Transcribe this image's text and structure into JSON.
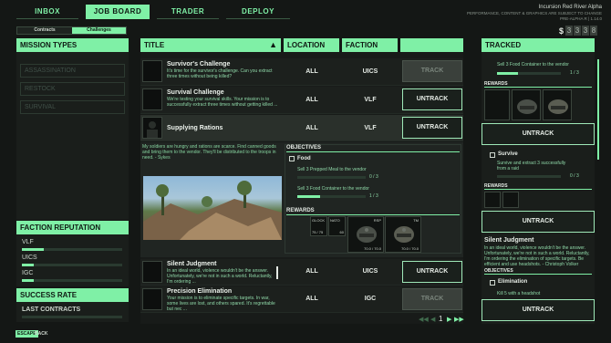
{
  "nav": {
    "tabs": [
      "INBOX",
      "JOB BOARD",
      "TRADER",
      "DEPLOY"
    ],
    "active": "JOB BOARD"
  },
  "build": {
    "line1": "Incursion Red River Alpha",
    "line2": "PERFORMANCE, CONTENT & GRAPHICS ARE SUBJECT TO CHANGE",
    "line3": "PRE-ALPHA R | 1.14.0"
  },
  "currency": {
    "symbol": "$",
    "digits": [
      "3",
      "3",
      "3",
      "8"
    ]
  },
  "sidebar": {
    "toggle": {
      "left": "Contracts",
      "right": "Challenges"
    },
    "mission_types_heading": "MISSION TYPES",
    "mission_types": [
      "ASSASSINATION",
      "RESTOCK",
      "SURVIVAL"
    ],
    "faction_rep_heading": "FACTION REPUTATION",
    "factions": [
      {
        "name": "VLF",
        "level": 0.22
      },
      {
        "name": "UICS",
        "level": 0.12
      },
      {
        "name": "IGC",
        "level": 0.12
      }
    ],
    "success_heading": "SUCCESS RATE",
    "last_contracts": "LAST CONTRACTS"
  },
  "table": {
    "headers": {
      "title": "TITLE",
      "location": "LOCATION",
      "faction": "FACTION"
    },
    "rows": [
      {
        "title": "Survivor's Challenge",
        "desc": "It's time for the survivor's challenge. Can you extract three times without being killed?",
        "location": "ALL",
        "faction": "UICS",
        "action": "TRACK",
        "disabled": true
      },
      {
        "title": "Survival Challenge",
        "desc": "We're testing your survival skills. Your mission is to successfully extract three times without getting killed ...",
        "location": "ALL",
        "faction": "VLF",
        "action": "UNTRACK",
        "disabled": false
      },
      {
        "title": "Supplying Rations",
        "desc": "",
        "location": "ALL",
        "faction": "VLF",
        "action": "UNTRACK",
        "disabled": false
      }
    ],
    "bottom_rows": [
      {
        "title": "Silent Judgment",
        "desc": "In an ideal world, violence wouldn't be the answer. Unfortunately, we're not in such a world. Reluctantly, I'm ordering ...",
        "location": "ALL",
        "faction": "UICS",
        "action": "UNTRACK",
        "disabled": false
      },
      {
        "title": "Precision Elimination",
        "desc": "Your mission is to eliminate specific targets. In war, some lives are lost, and others spared. It's regrettable but nec ...",
        "location": "ALL",
        "faction": "IGC",
        "action": "TRACK",
        "disabled": true
      }
    ]
  },
  "detail": {
    "quote": "My soldiers are hungry and rations are scarce. Find canned goods and bring them to the vendor. They'll be distributed to the troops in need. - Sykes",
    "objectives_heading": "OBJECTIVES",
    "objective_group": "Food",
    "objectives": [
      {
        "text": "Sell 3 Prepped Meal to the vendor",
        "count": "0 / 3",
        "progress": 0.0
      },
      {
        "text": "Sell 3 Food Container to the vendor",
        "count": "1 / 3",
        "progress": 0.33
      }
    ],
    "rewards_heading": "REWARDS",
    "rewards": [
      {
        "name": "GLOCK",
        "price": "75 / 75"
      },
      {
        "name": "NATO",
        "price": "60"
      },
      {
        "name": "RSP",
        "price": "70.0 / 70.0"
      },
      {
        "name": "TM",
        "price": "70.0 / 70.0"
      }
    ]
  },
  "pager": {
    "page": "1"
  },
  "tracked": {
    "heading": "TRACKED",
    "item1": {
      "objective": "Sell 3 Food Container to the vendor",
      "count": "1 / 3",
      "rewards_heading": "REWARDS",
      "action": "UNTRACK"
    },
    "item2": {
      "group": "Survive",
      "objective": "Survive and extract 3 successfully from a raid",
      "count": "0 / 3",
      "rewards_heading": "REWARDS",
      "action": "UNTRACK"
    },
    "item3": {
      "title": "Silent Judgment",
      "desc": "In an ideal world, violence wouldn't be the answer. Unfortunately, we're not in such a world. Reluctantly, I'm ordering the elimination of specific targets. Be efficient and use headshots. - Christoph Volker",
      "objectives_heading": "OBJECTIVES",
      "group": "Elimination",
      "objective": "Kill 5 with a headshot",
      "action": "UNTRACK"
    }
  },
  "footer": {
    "key": "ESCAPE",
    "label": "BACK"
  }
}
